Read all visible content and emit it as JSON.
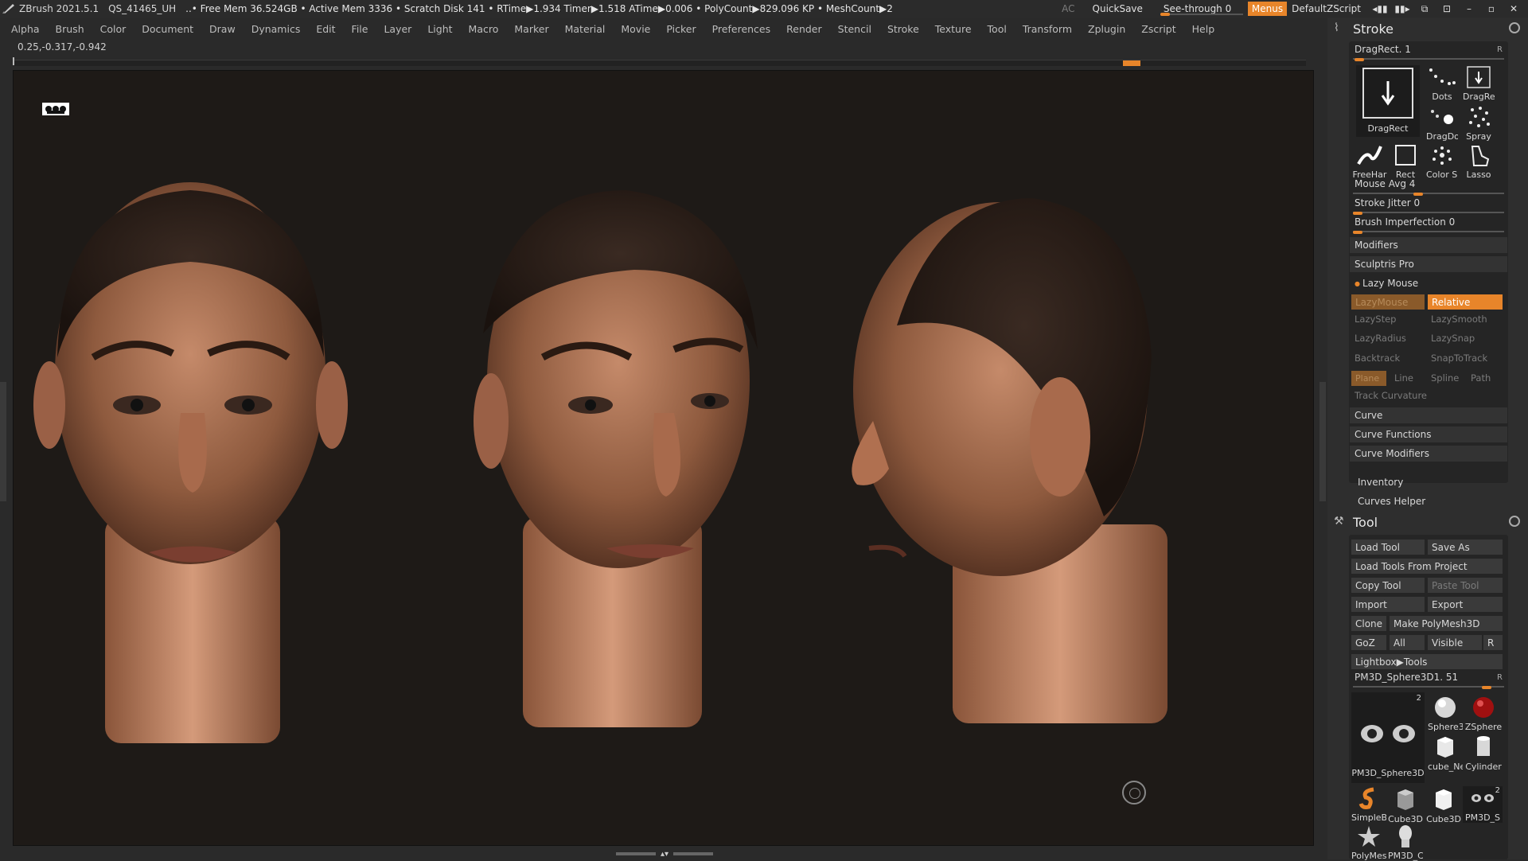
{
  "titlebar": {
    "app": "ZBrush 2021.5.1",
    "doc": "QS_41465_UH",
    "stats": "..• Free Mem 36.524GB • Active Mem 3336 • Scratch Disk 141 • RTime▶1.934 Timer▶1.518 ATime▶0.006 • PolyCount▶829.096 KP • MeshCount▶2",
    "ac": "AC",
    "quicksave": "QuickSave",
    "seethrough": "See-through  0",
    "seethrough_value": 0,
    "menus": "Menus",
    "script": "DefaultZScript"
  },
  "menubar": {
    "items": [
      "Alpha",
      "Brush",
      "Color",
      "Document",
      "Draw",
      "Dynamics",
      "Edit",
      "File",
      "Layer",
      "Light",
      "Macro",
      "Marker",
      "Material",
      "Movie",
      "Picker",
      "Preferences",
      "Render",
      "Stencil",
      "Stroke",
      "Texture",
      "Tool",
      "Transform",
      "Zplugin",
      "Zscript",
      "Help"
    ]
  },
  "coords": "0.25,-0.317,-0.942",
  "stroke": {
    "title": "Stroke",
    "dragrect": "DragRect. 1",
    "r": "R",
    "thumbs": [
      "DragRect",
      "Dots",
      "DragRec",
      "DragDo",
      "Spray",
      "FreeHar",
      "Rect",
      "Color Sp",
      "Lasso"
    ],
    "mouse_avg": "Mouse Avg 4",
    "mouse_avg_value": 4,
    "stroke_jitter": "Stroke Jitter 0",
    "brush_imperfection": "Brush Imperfection 0",
    "modifiers": "Modifiers",
    "sculptris": "Sculptris Pro",
    "lazymouse_header": "Lazy Mouse",
    "lazymouse": "LazyMouse",
    "relative": "Relative",
    "lazystep": "LazyStep",
    "lazysmooth": "LazySmooth",
    "lazyradius": "LazyRadius",
    "lazysnap": "LazySnap",
    "backtrack": "Backtrack",
    "snaptotrack": "SnapToTrack",
    "plane": "Plane",
    "line": "Line",
    "spline": "Spline",
    "path": "Path",
    "track_curvature": "Track Curvature",
    "curve": "Curve",
    "curve_functions": "Curve Functions",
    "curve_modifiers": "Curve Modifiers",
    "inventory": "Inventory",
    "curves_helper": "Curves Helper"
  },
  "tool": {
    "title": "Tool",
    "load_tool": "Load Tool",
    "save_as": "Save As",
    "load_from_project": "Load Tools From Project",
    "copy_tool": "Copy Tool",
    "paste_tool": "Paste Tool",
    "import": "Import",
    "export": "Export",
    "clone": "Clone",
    "make_polymesh": "Make PolyMesh3D",
    "goz": "GoZ",
    "all": "All",
    "visible": "Visible",
    "r": "R",
    "lightbox": "Lightbox▶Tools",
    "current": "PM3D_Sphere3D1. 51",
    "current_value": 51,
    "count_badge": "2",
    "count_badge2": "2",
    "thumbs": [
      "PM3D_Sphere3D",
      "Sphere3",
      "ZSphere",
      "cube_Ne",
      "Cylinder",
      "SimpleB",
      "Cube3D",
      "Cube3D",
      "PM3D_S",
      "PolyMes",
      "PM3D_C"
    ]
  },
  "colors": {
    "accent": "#e8852a",
    "panel_bg": "#2e2e2e",
    "canvas_bg": "#1e1a17"
  }
}
